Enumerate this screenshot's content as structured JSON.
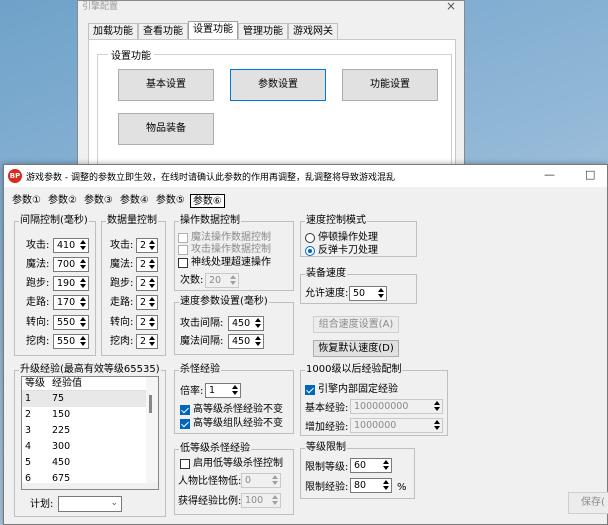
{
  "back_window": {
    "title": "引擎配置",
    "close": "×",
    "tabs": [
      "加载功能",
      "查看功能",
      "设置功能",
      "管理功能",
      "游戏网关"
    ],
    "selected_tab": 2,
    "group_label": "设置功能",
    "buttons": [
      "基本设置",
      "参数设置",
      "功能设置",
      "物品装备"
    ]
  },
  "main_window": {
    "icon_text": "BP",
    "title": "游戏参数 - 调整的参数立即生效，在线时请确认此参数的作用再调整，乱调整将导致游戏混乱",
    "controls": {
      "minimize": "—",
      "maximize": "□"
    },
    "tabs": [
      "参数①",
      "参数②",
      "参数③",
      "参数④",
      "参数⑤",
      "参数⑥"
    ],
    "selected_tab": 5
  },
  "interval": {
    "label": "间隔控制(毫秒)",
    "rows": [
      {
        "label": "攻击:",
        "value": "410"
      },
      {
        "label": "魔法:",
        "value": "700"
      },
      {
        "label": "跑步:",
        "value": "190"
      },
      {
        "label": "走路:",
        "value": "170"
      },
      {
        "label": "转向:",
        "value": "550"
      },
      {
        "label": "挖肉:",
        "value": "550"
      }
    ]
  },
  "count": {
    "label": "数据量控制",
    "rows": [
      {
        "label": "攻击:",
        "value": "2"
      },
      {
        "label": "魔法:",
        "value": "2"
      },
      {
        "label": "跑步:",
        "value": "2"
      },
      {
        "label": "走路:",
        "value": "2"
      },
      {
        "label": "转向:",
        "value": "2"
      },
      {
        "label": "挖肉:",
        "value": "2"
      }
    ]
  },
  "opdata": {
    "label": "操作数据控制",
    "options": [
      {
        "label": "魔法操作数据控制",
        "checked": false,
        "disabled": true
      },
      {
        "label": "攻击操作数据控制",
        "checked": false,
        "disabled": true
      },
      {
        "label": "神线处理超速操作",
        "checked": false,
        "disabled": false
      }
    ],
    "times_label": "次数:",
    "times_value": "20"
  },
  "speed_mode": {
    "label": "速度控制模式",
    "options": [
      {
        "label": "停顿操作处理",
        "selected": false
      },
      {
        "label": "反弹卡刀处理",
        "selected": true
      }
    ]
  },
  "equip_speed": {
    "label": "装备速度",
    "allow_label": "允许速度:",
    "allow_value": "50"
  },
  "speed_param": {
    "label": "速度参数设置(毫秒)",
    "attack_label": "攻击间隔:",
    "attack_value": "450",
    "magic_label": "魔法间隔:",
    "magic_value": "450"
  },
  "combo_btn": "组合速度设置(A)",
  "reset_btn": "恢复默认速度(D)",
  "levelexp": {
    "label": "升级经验(最高有效等级65535)",
    "col_level": "等级",
    "col_exp": "经验值",
    "rows": [
      {
        "level": "1",
        "exp": "75"
      },
      {
        "level": "2",
        "exp": "150"
      },
      {
        "level": "3",
        "exp": "225"
      },
      {
        "level": "4",
        "exp": "300"
      },
      {
        "level": "5",
        "exp": "450"
      },
      {
        "level": "6",
        "exp": "675"
      }
    ],
    "plan_label": "计划:",
    "plan_value": ""
  },
  "kill_exp": {
    "label": "杀怪经验",
    "mult_label": "倍率:",
    "mult_value": "1",
    "options": [
      {
        "label": "高等级杀怪经验不变",
        "checked": true
      },
      {
        "label": "高等级组队经验不变",
        "checked": true
      }
    ]
  },
  "low_kill": {
    "label": "低等级杀怪经验",
    "enable_label": "启用低等级杀怪控制",
    "enable_checked": false,
    "ratio_label": "人物比怪物低:",
    "ratio_value": "0",
    "gain_label": "获得经验比例:",
    "gain_value": "100"
  },
  "exp1000": {
    "label": "1000级以后经验配制",
    "fixed_label": "引擎内部固定经验",
    "fixed_checked": true,
    "base_label": "基本经验:",
    "base_value": "100000000",
    "add_label": "增加经验:",
    "add_value": "1000000"
  },
  "level_limit": {
    "label": "等级限制",
    "limit_label": "限制等级:",
    "limit_value": "60",
    "exp_label": "限制经验:",
    "exp_value": "80",
    "exp_unit": "%"
  },
  "save_btn": "保存("
}
